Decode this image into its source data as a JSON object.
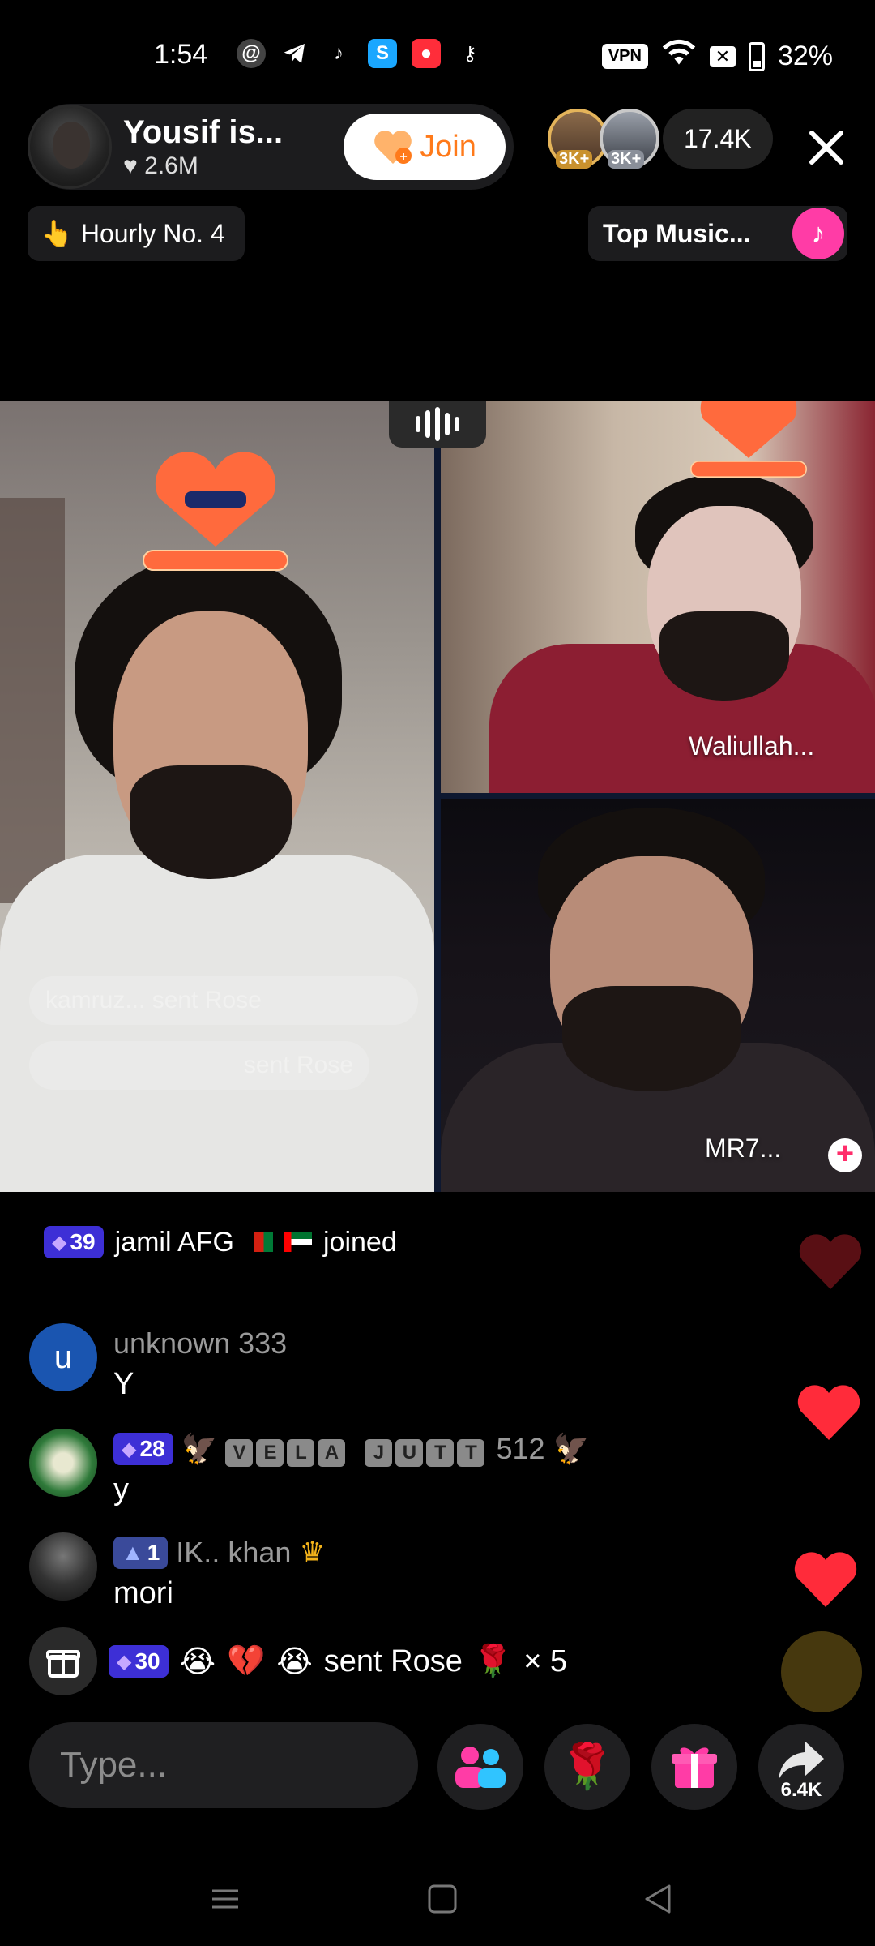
{
  "status_bar": {
    "time": "1:54",
    "vpn_label": "VPN",
    "battery": "32%",
    "app_icons": [
      "at-icon",
      "telegram-icon",
      "tiktok-icon",
      "shortcut-icon",
      "record-icon",
      "key-icon"
    ]
  },
  "host": {
    "name": "Yousif is...",
    "likes": "2.6M",
    "join_label": "Join"
  },
  "viewers": {
    "badges": [
      "3K+",
      "3K+"
    ],
    "count": "17.4K"
  },
  "tags": {
    "hourly": "Hourly No. 4",
    "top_music": "Top Music..."
  },
  "guests": [
    {
      "name": "Waliullah..."
    },
    {
      "name": "MR7..."
    }
  ],
  "overlays": {
    "ghost_1": "kamruz... sent Rose",
    "ghost_2": "sent Rose"
  },
  "chat": {
    "join_event": {
      "level": "39",
      "user": "jamil AFG",
      "action": "joined"
    },
    "messages": [
      {
        "avatar_letter": "u",
        "name": "unknown 333",
        "text": "Y"
      },
      {
        "level": "28",
        "name_letters": [
          "V",
          "E",
          "L",
          "A",
          "J",
          "U",
          "T",
          "T"
        ],
        "name_suffix": "512",
        "text": "y"
      },
      {
        "level": "1",
        "name": "IK.. khan",
        "text": "mori"
      }
    ],
    "gift_event": {
      "level": "30",
      "text": "sent Rose",
      "multiplier": "× 5"
    }
  },
  "bottom": {
    "input_placeholder": "Type...",
    "share_count": "6.4K"
  },
  "colors": {
    "accent_join": "#ff7a1a",
    "level_badge": "#3d2fd6",
    "heart": "#ff2b3a",
    "music_pink": "#ff3ca6"
  }
}
